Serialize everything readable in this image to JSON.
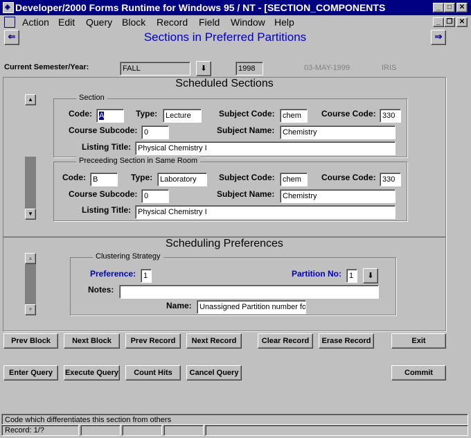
{
  "window": {
    "title": "Developer/2000 Forms Runtime for Windows 95 / NT - [SECTION_COMPONENTS",
    "app_icon": "oracle-forms-icon",
    "caption_buttons": [
      "_",
      "□",
      "✕"
    ],
    "mdi_buttons": [
      "_",
      "❐",
      "✕"
    ]
  },
  "menu": {
    "items": [
      "Action",
      "Edit",
      "Query",
      "Block",
      "Record",
      "Field",
      "Window",
      "Help"
    ]
  },
  "header": {
    "title": "Sections in Preferred Partitions",
    "prev_arrow": "⇐",
    "next_arrow": "⇒",
    "semester_label": "Current Semester/Year:",
    "semester_value": "FALL",
    "year_value": "1998",
    "date_value": "03-MAY-1999",
    "user_value": "IRIS",
    "dropdown_glyph": "⬇"
  },
  "scheduled": {
    "title": "Scheduled Sections",
    "section_group": {
      "title": "Section",
      "code_label": "Code:",
      "code_value": "A",
      "type_label": "Type:",
      "type_value": "Lecture",
      "subject_code_label": "Subject Code:",
      "subject_code_value": "chem",
      "course_code_label": "Course Code:",
      "course_code_value": "330",
      "course_subcode_label": "Course Subcode:",
      "course_subcode_value": "0",
      "subject_name_label": "Subject Name:",
      "subject_name_value": "Chemistry",
      "listing_title_label": "Listing Title:",
      "listing_title_value": "Physical Chemistry I"
    },
    "preceding_group": {
      "title": "Preceeding Section in Same Room",
      "code_label": "Code:",
      "code_value": "B",
      "type_label": "Type:",
      "type_value": "Laboratory",
      "subject_code_label": "Subject Code:",
      "subject_code_value": "chem",
      "course_code_label": "Course Code:",
      "course_code_value": "330",
      "course_subcode_label": "Course Subcode:",
      "course_subcode_value": "0",
      "subject_name_label": "Subject Name:",
      "subject_name_value": "Chemistry",
      "listing_title_label": "Listing Title:",
      "listing_title_value": "Physical Chemistry I"
    }
  },
  "preferences": {
    "title": "Scheduling Preferences",
    "group_title": "Clustering Strategy",
    "preference_label": "Preference:",
    "preference_value": "1",
    "partition_label": "Partition No:",
    "partition_value": "1",
    "notes_label": "Notes:",
    "notes_value": "",
    "name_label": "Name:",
    "name_value": "Unassigned Partition number for"
  },
  "buttons": {
    "row1": [
      "Prev Block",
      "Next Block",
      "Prev Record",
      "Next Record",
      "Clear Record",
      "Erase Record",
      "Exit"
    ],
    "row2": [
      "Enter Query",
      "Execute Query",
      "Count Hits",
      "Cancel Query",
      "Commit"
    ]
  },
  "status": {
    "message": "Code which differentiates this section from others",
    "record": "Record: 1/?"
  }
}
